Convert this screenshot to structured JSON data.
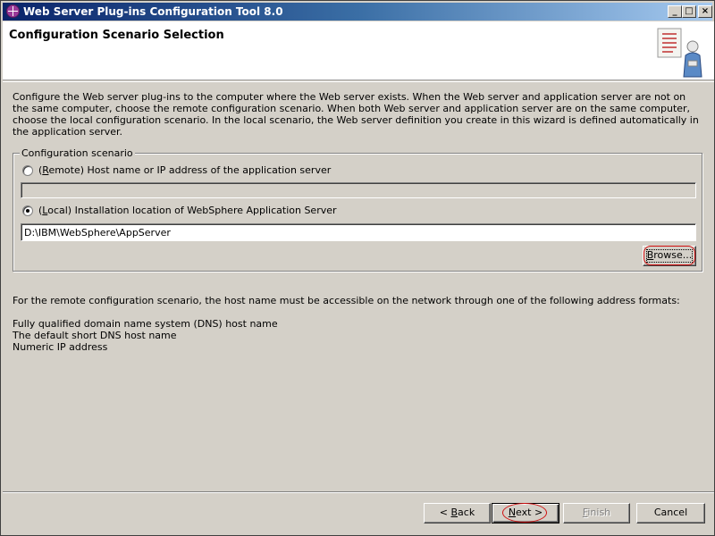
{
  "window": {
    "title": "Web Server Plug-ins Configuration Tool 8.0",
    "controls": {
      "minimize": "_",
      "maximize": "□",
      "close": "×"
    }
  },
  "header": {
    "page_title": "Configuration Scenario Selection",
    "icon": "wizard-icon"
  },
  "intro_text": "Configure the Web server plug-ins to the computer where the Web server exists. When the Web server and application server are not on the same computer, choose the remote configuration scenario. When both Web server and application server are on the same computer, choose the local configuration scenario. In the local scenario, the Web server definition you create in this wizard is defined automatically in the application server.",
  "scenario_group": {
    "legend": "Configuration scenario",
    "remote": {
      "prefix": "(",
      "mnemonic": "R",
      "label_rest": "emote) Host name or IP address of the application server",
      "selected": false,
      "value": ""
    },
    "local": {
      "prefix": "(",
      "mnemonic": "L",
      "label_rest": "ocal) Installation location of WebSphere Application Server",
      "selected": true,
      "value": "D:\\IBM\\WebSphere\\AppServer"
    },
    "browse_button": {
      "mnemonic": "B",
      "rest": "rowse..."
    }
  },
  "remote_info": "For the remote configuration scenario, the host name must be accessible on the network through one of the following address formats:",
  "address_formats": [
    "Fully qualified domain name system (DNS) host name",
    "The default short DNS host name",
    "Numeric IP address"
  ],
  "nav_buttons": {
    "back": {
      "pre": "< ",
      "mnemonic": "B",
      "rest": "ack",
      "enabled": true
    },
    "next": {
      "mnemonic": "N",
      "rest": "ext >",
      "enabled": true
    },
    "finish": {
      "mnemonic": "F",
      "rest": "inish",
      "enabled": false
    },
    "cancel": {
      "label": "Cancel",
      "enabled": true
    }
  },
  "colors": {
    "face": "#d4d0c8",
    "titlebar_start": "#0a246a",
    "titlebar_end": "#a6caf0",
    "highlight_circle": "#d01010"
  }
}
